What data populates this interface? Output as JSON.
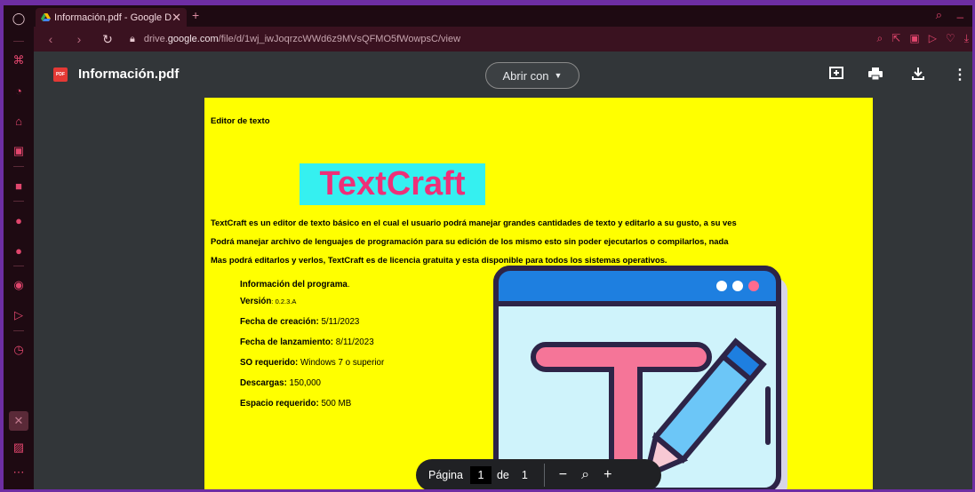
{
  "browser": {
    "tab_title": "Información.pdf - Google D",
    "tab_close": "✕",
    "new_tab": "+",
    "url_prefix": "drive.",
    "url_domain": "google.com",
    "url_path": "/file/d/1wj_iwJoqrzcWWd6z9MVsQFMO5fWowpsC/view"
  },
  "viewer": {
    "file_title": "Información.pdf",
    "pdf_badge": "PDF",
    "open_with_label": "Abrir con"
  },
  "document": {
    "editor_label": "Editor de texto",
    "product_title": "TextCraft",
    "description_lines": [
      "TextCraft es un editor de texto básico en el cual el usuario podrá manejar grandes cantidades de texto y editarlo a su gusto, a su ves",
      "Podrá manejar archivo de lenguajes de programación para su edición de los mismo esto sin poder ejecutarlos o compilarlos, nada",
      "Mas podrá editarlos y verlos, TextCraft es de licencia gratuita y esta disponible para todos los sistemas operativos."
    ],
    "info_heading": "Información del programa",
    "info_heading_dot": ".",
    "version_label": "Versión",
    "version_value": ": 0.2.3.A",
    "fields": [
      {
        "label": "Fecha de creación:",
        "value": " 5/11/2023"
      },
      {
        "label": "Fecha de lanzamiento:",
        "value": " 8/11/2023"
      },
      {
        "label": "SO requerido:",
        "value": " Windows 7 o superior"
      },
      {
        "label": "Descargas:",
        "value": " 150,000"
      },
      {
        "label": "Espacio requerido:",
        "value": " 500 MB"
      }
    ]
  },
  "page_toolbar": {
    "page_label": "Página",
    "current_page": "1",
    "of_label": "de",
    "total_pages": "1",
    "zoom_out": "−",
    "zoom_in": "+"
  },
  "colors": {
    "page_bg": "#ffff00",
    "title_bg": "#35f0f0",
    "title_text": "#ee2f78",
    "accent": "#e0466d"
  }
}
